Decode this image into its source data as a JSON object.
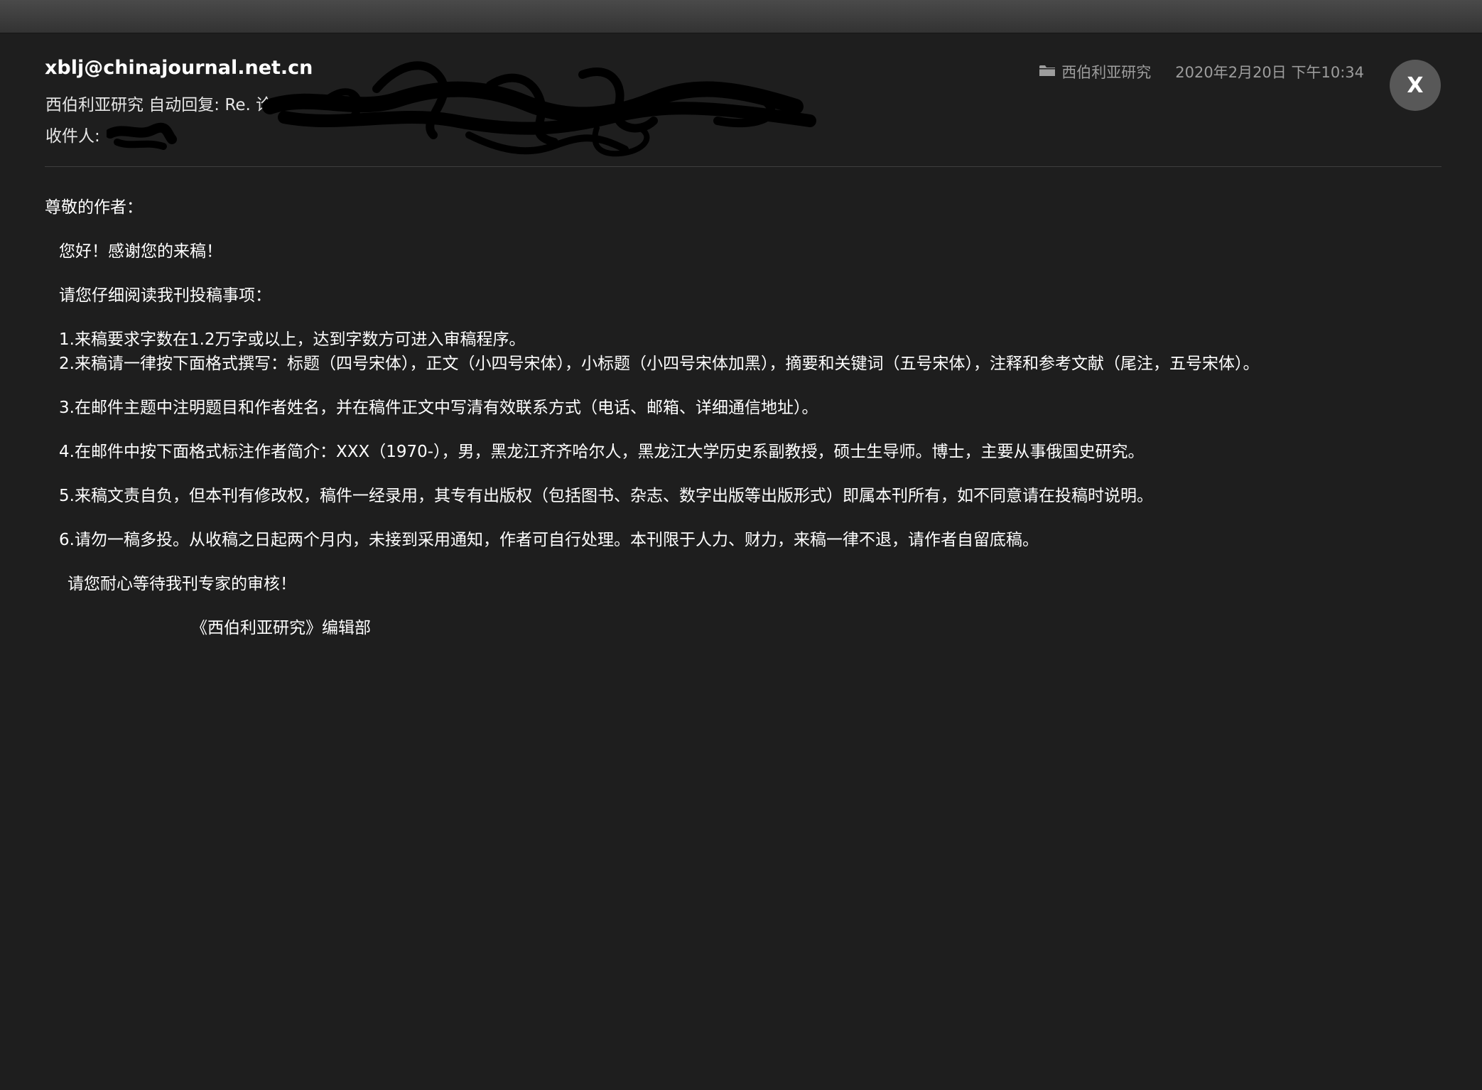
{
  "header": {
    "sender": "xblj@chinajournal.net.cn",
    "subject": "西伯利亚研究 自动回复: Re. 论",
    "recipient_label": "收件人:",
    "mailbox": "西伯利亚研究",
    "date": "2020年2月20日 下午10:34",
    "close_label": "X"
  },
  "message": {
    "greeting": "尊敬的作者：",
    "thanks": "您好！感谢您的来稿！",
    "intro": "请您仔细阅读我刊投稿事项：",
    "rules": [
      "1.来稿要求字数在1.2万字或以上，达到字数方可进入审稿程序。",
      "2.来稿请一律按下面格式撰写：标题（四号宋体），正文（小四号宋体），小标题（小四号宋体加黑），摘要和关键词（五号宋体），注释和参考文献（尾注，五号宋体）。",
      "3.在邮件主题中注明题目和作者姓名，并在稿件正文中写清有效联系方式（电话、邮箱、详细通信地址）。",
      "4.在邮件中按下面格式标注作者简介：XXX（1970-），男，黑龙江齐齐哈尔人，黑龙江大学历史系副教授，硕士生导师。博士，主要从事俄国史研究。",
      "5.来稿文责自负，但本刊有修改权，稿件一经录用，其专有出版权（包括图书、杂志、数字出版等出版形式）即属本刊所有，如不同意请在投稿时说明。",
      "6.请勿一稿多投。从收稿之日起两个月内，未接到采用通知，作者可自行处理。本刊限于人力、财力，来稿一律不退，请作者自留底稿。"
    ],
    "closing": "请您耐心等待我刊专家的审核！",
    "signature": "《西伯利亚研究》编辑部"
  },
  "icons": {
    "mailbox_icon": "folder-icon",
    "close_icon": "close-icon"
  },
  "colors": {
    "background": "#1e1e1e",
    "text": "#ffffff",
    "meta_text": "#9d9d9d",
    "close_button": "#585858"
  }
}
